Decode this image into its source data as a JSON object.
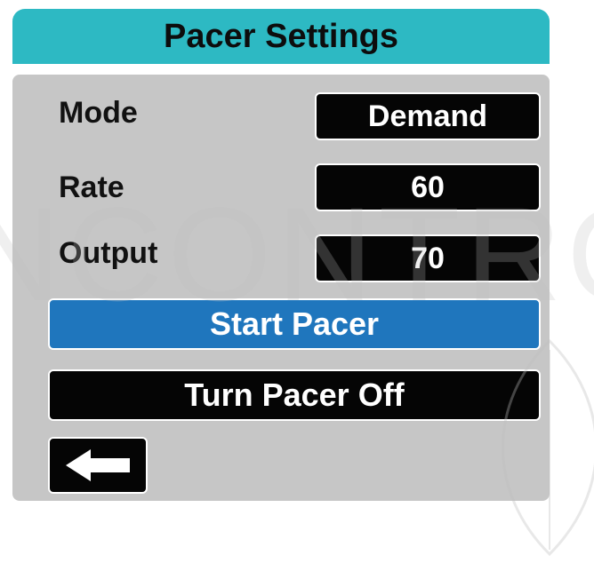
{
  "title": "Pacer Settings",
  "settings": [
    {
      "label": "Mode",
      "value": "Demand"
    },
    {
      "label": "Rate",
      "value": "60"
    },
    {
      "label": "Output",
      "value": "70"
    }
  ],
  "buttons": {
    "start": "Start Pacer",
    "off": "Turn Pacer Off"
  },
  "icons": {
    "back": "arrow-left-icon"
  },
  "watermark": "NCONTRO",
  "colors": {
    "title_bar": "#2db9c3",
    "panel": "#c6c6c6",
    "start_button": "#1f76bd",
    "value_box": "#050505"
  }
}
